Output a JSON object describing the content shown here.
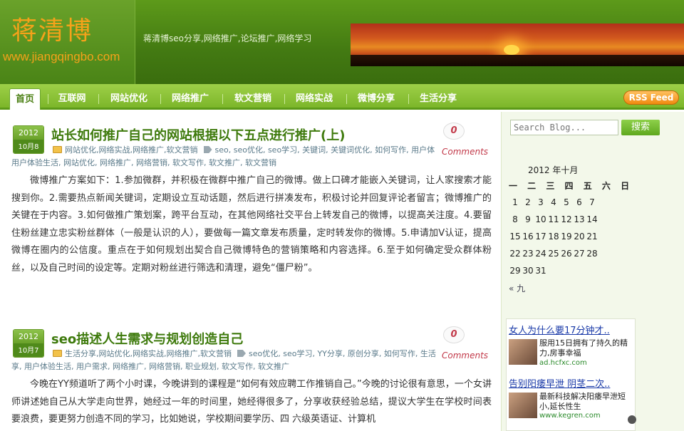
{
  "header": {
    "logo_title": "蒋清博",
    "logo_url": "www.jiangqingbo.com",
    "tagline": "蒋清博seo分享,网络推广,论坛推广,网络学习"
  },
  "nav": {
    "items": [
      "首页",
      "互联网",
      "网站优化",
      "网络推广",
      "软文营销",
      "网络实战",
      "微博分享",
      "生活分享"
    ],
    "active": "首页",
    "rss": "RSS Feed"
  },
  "posts": [
    {
      "year": "2012",
      "day": "10月8",
      "title": "站长如何推广自己的网站根据以下五点进行推广(上)",
      "comment_count": "0",
      "comments_label": "Comments",
      "categories": "网站优化,网络实战,网络推广,软文营销",
      "tags_line1": "seo, seo优化, seo学习, 关键词, 关键词优化, 如何写作, 用户体",
      "tags_line2": "用户体验生活, 网站优化, 网络推广, 网络营销, 软文写作, 软文推广, 软文营销",
      "body": "微博推广方案如下：1.参加微群，并积极在微群中推广自己的微博。做上口碑才能嵌入关键词，让人家搜索才能搜到你。2.需要热点新闻关键词，定期设立互动话题，然后进行拼凑发布，积极讨论并回复评论者留言；微博推广的关键在于内容。3.如何做推广策划案，跨平台互动，在其他网络社交平台上转发自己的微博，以提高关注度。4.要留住粉丝建立忠实粉丝群体（一般是认识的人），要做每一篇文章发布质量，定时转发你的微博。5.申请加V认证，提高微博在圈内的公信度。重点在于如何规划出契合自己微博特色的营销策略和内容选择。6.至于如何确定受众群体粉丝，以及自己时间的设定等。定期对粉丝进行筛选和清理，避免“僵尸粉”。"
    },
    {
      "year": "2012",
      "day": "10月7",
      "title": "seo描述人生需求与规划创造自己",
      "comment_count": "0",
      "comments_label": "Comments",
      "categories": "生活分享,网站优化,网络实战,网络推广,软文营销",
      "tags_line1": "seo优化, seo学习, YY分享, 原创分享, 如何写作, 生活",
      "tags_line2": "享, 用户体验生活, 用户需求, 网络推广, 网络营销, 职业规划, 软文写作, 软文推广",
      "body": "今晚在YY频道听了两个小时课，今晚讲到的课程是“如何有效应聘工作推销自己。”今晚的讨论很有意思，一个女讲师讲述她自己从大学走向世界，她经过一年的时间里，她经得很多了，分享收获经验总结，提议大学生在学校时间表要浪费，要更努力创造不同的学习，比如她说，学校期间要学历、四 六级英语证、计算机"
    }
  ],
  "sidebar": {
    "search_placeholder": "Search Blog...",
    "search_button": "搜索",
    "calendar": {
      "caption": "2012 年十月",
      "weekdays": "一 二 三 四 五 六 日",
      "rows": [
        [
          "1",
          "2",
          "3",
          "4",
          "5",
          "6",
          "7"
        ],
        [
          "8",
          "9",
          "10",
          "11",
          "12",
          "13",
          "14"
        ],
        [
          "15",
          "16",
          "17",
          "18",
          "19",
          "20",
          "21"
        ],
        [
          "22",
          "23",
          "24",
          "25",
          "26",
          "27",
          "28"
        ],
        [
          "29",
          "30",
          "31"
        ]
      ],
      "prev": "« 九"
    },
    "ads": [
      {
        "title": "女人为什么要17分钟才..",
        "text": "服用15日拥有了持久的精力,房事幸福",
        "url": "ad.hcfxc.com"
      },
      {
        "title": "告别阳痿早泄 阴茎二次..",
        "text": "最新科技解决阳痿早泄短小,延长性生",
        "url": "www.kegren.com"
      }
    ]
  }
}
